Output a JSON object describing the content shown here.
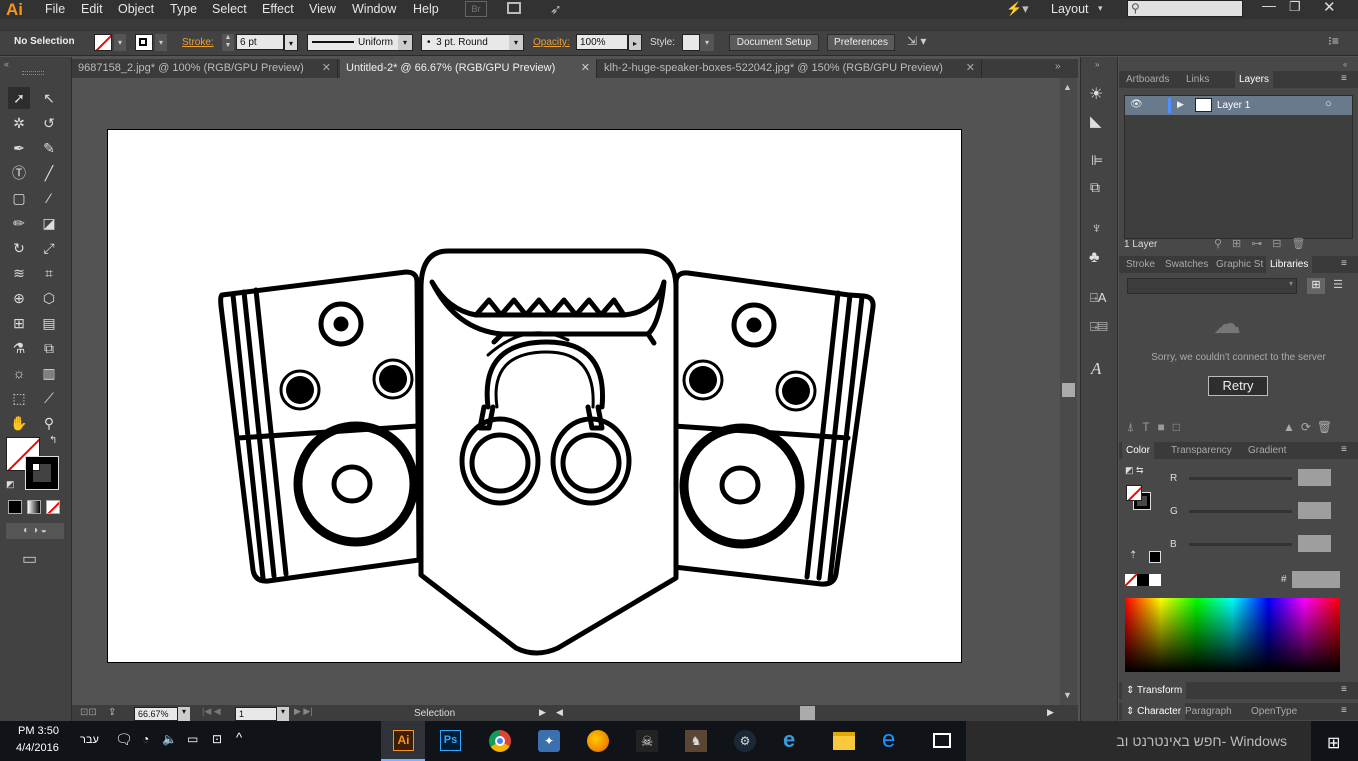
{
  "app": {
    "logo": "Ai"
  },
  "menu": [
    "File",
    "Edit",
    "Object",
    "Type",
    "Select",
    "Effect",
    "View",
    "Window",
    "Help"
  ],
  "menu_right": {
    "workspace": "Layout",
    "br": "Br"
  },
  "control": {
    "selection": "No Selection",
    "stroke_label": "Stroke:",
    "stroke_value": "6 pt",
    "profile": "Uniform",
    "brush": "3 pt. Round",
    "opacity_label": "Opacity:",
    "opacity_value": "100%",
    "style_label": "Style:",
    "doc_setup": "Document Setup",
    "preferences": "Preferences"
  },
  "tabs": [
    "9687158_2.jpg* @ 100% (RGB/GPU Preview)",
    "Untitled-2* @ 66.67% (RGB/GPU Preview)",
    "klh-2-huge-speaker-boxes-522042.jpg* @ 150% (RGB/GPU Preview)"
  ],
  "status": {
    "zoom": "66.67%",
    "artboard": "1",
    "tool": "Selection"
  },
  "layers": {
    "tabs": [
      "Artboards",
      "Links",
      "Layers"
    ],
    "layer1": "Layer 1",
    "count": "1 Layer"
  },
  "libraries": {
    "tabs": [
      "Stroke",
      "Swatches",
      "Graphic St",
      "Libraries"
    ],
    "error": "Sorry, we couldn't connect to the server",
    "retry": "Retry"
  },
  "color": {
    "tabs": [
      "Color",
      "Transparency",
      "Gradient"
    ],
    "r": "R",
    "g": "G",
    "b": "B",
    "hash": "#"
  },
  "transform": {
    "label": "Transform"
  },
  "character": {
    "tabs": [
      "Character",
      "Paragraph",
      "OpenType"
    ]
  },
  "taskbar": {
    "time": "PM 3:50",
    "date": "4/4/2016",
    "lang": "עבר",
    "search": "חפש באינטרנט וב- Windows"
  }
}
